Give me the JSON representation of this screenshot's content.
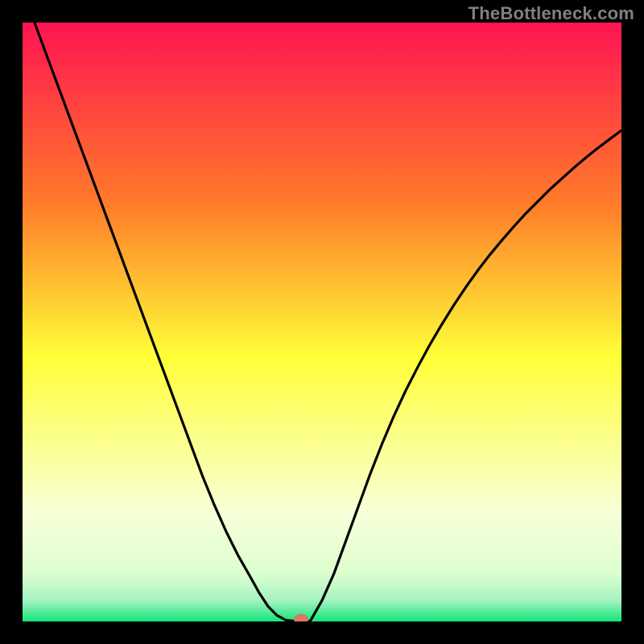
{
  "watermark": "TheBottleneck.com",
  "colors": {
    "frame": "#000000",
    "gradient_top": "#ff1452",
    "gradient_mid1": "#ff8a2a",
    "gradient_mid2": "#ffff32",
    "gradient_bottom_pale": "#f6ffde",
    "gradient_bottom": "#12e67a",
    "curve": "#000000",
    "marker": "#d87866"
  },
  "chart_data": {
    "type": "line",
    "title": "",
    "xlabel": "",
    "ylabel": "",
    "xlim": [
      0,
      100
    ],
    "ylim": [
      0,
      100
    ],
    "x": [
      0,
      2,
      4,
      6,
      8,
      10,
      12,
      14,
      16,
      18,
      20,
      22,
      24,
      26,
      28,
      30,
      32,
      34,
      36,
      38,
      39.5,
      41,
      42.5,
      44,
      46,
      48,
      50,
      52,
      54,
      56,
      58,
      60,
      62,
      64,
      66,
      68,
      70,
      72,
      74,
      76,
      78,
      80,
      82,
      84,
      86,
      88,
      90,
      92,
      94,
      96,
      98,
      100
    ],
    "y": [
      null,
      100,
      94.6,
      89.2,
      83.8,
      78.4,
      73.0,
      67.6,
      62.2,
      56.8,
      51.4,
      46.0,
      40.6,
      35.2,
      29.8,
      24.4,
      19.5,
      15.0,
      11.0,
      7.5,
      4.8,
      2.5,
      1.0,
      0.2,
      0,
      0,
      3.5,
      8.0,
      13.5,
      19.0,
      24.5,
      29.6,
      34.3,
      38.6,
      42.5,
      46.2,
      49.6,
      52.8,
      55.8,
      58.6,
      61.2,
      63.6,
      65.9,
      68.1,
      70.1,
      72.1,
      73.9,
      75.7,
      77.4,
      79.0,
      80.5,
      82.0
    ],
    "marker": {
      "x": 46.5,
      "y": 0.4
    },
    "gradient_stops": [
      {
        "offset": 0.0,
        "color": "#ff1452"
      },
      {
        "offset": 0.3,
        "color": "#ff7a2a"
      },
      {
        "offset": 0.56,
        "color": "#ffff38"
      },
      {
        "offset": 0.82,
        "color": "#f8ffd8"
      },
      {
        "offset": 0.92,
        "color": "#dcffd0"
      },
      {
        "offset": 0.965,
        "color": "#a6f2c2"
      },
      {
        "offset": 1.0,
        "color": "#10e678"
      }
    ]
  }
}
